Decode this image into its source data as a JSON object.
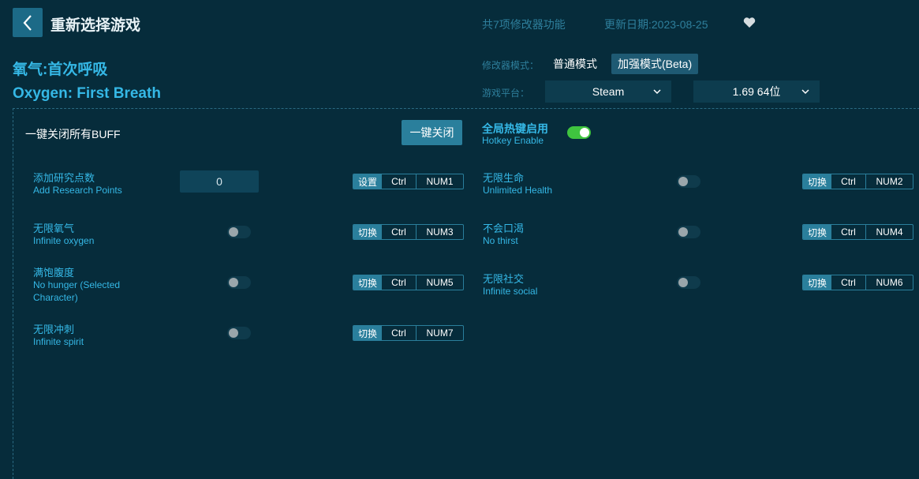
{
  "header": {
    "title": "重新选择游戏",
    "feature_count": "共7项修改器功能",
    "update_date": "更新日期:2023-08-25"
  },
  "game": {
    "title_cn": "氧气:首次呼吸",
    "title_en": "Oxygen: First Breath"
  },
  "mode": {
    "label": "修改器模式：",
    "normal": "普通模式",
    "enhanced": "加强模式(Beta)"
  },
  "platform": {
    "label": "游戏平台：",
    "selected": "Steam",
    "version": "1.69 64位"
  },
  "controls": {
    "close_all_label": "一键关闭所有BUFF",
    "close_all_button": "一键关闭",
    "hotkey_cn": "全局热键启用",
    "hotkey_en": "Hotkey Enable"
  },
  "options": [
    {
      "cn": "添加研究点数",
      "en": "Add Research Points",
      "value": "0",
      "key1": "设置",
      "key2": "Ctrl",
      "key3": "NUM1"
    },
    {
      "cn": "无限生命",
      "en": "Unlimited Health",
      "key1": "切换",
      "key2": "Ctrl",
      "key3": "NUM2"
    },
    {
      "cn": "无限氧气",
      "en": "Infinite oxygen",
      "key1": "切换",
      "key2": "Ctrl",
      "key3": "NUM3"
    },
    {
      "cn": "不会口渴",
      "en": "No thirst",
      "key1": "切换",
      "key2": "Ctrl",
      "key3": "NUM4"
    },
    {
      "cn": "满饱腹度",
      "en": "No hunger (Selected Character)",
      "key1": "切换",
      "key2": "Ctrl",
      "key3": "NUM5"
    },
    {
      "cn": "无限社交",
      "en": "Infinite social",
      "key1": "切换",
      "key2": "Ctrl",
      "key3": "NUM6"
    },
    {
      "cn": "无限冲刺",
      "en": "Infinite spirit",
      "key1": "切换",
      "key2": "Ctrl",
      "key3": "NUM7"
    }
  ],
  "colors": {
    "background": "#062c3b",
    "accent": "#35b8e6",
    "toggle_on": "#3fc43f"
  }
}
